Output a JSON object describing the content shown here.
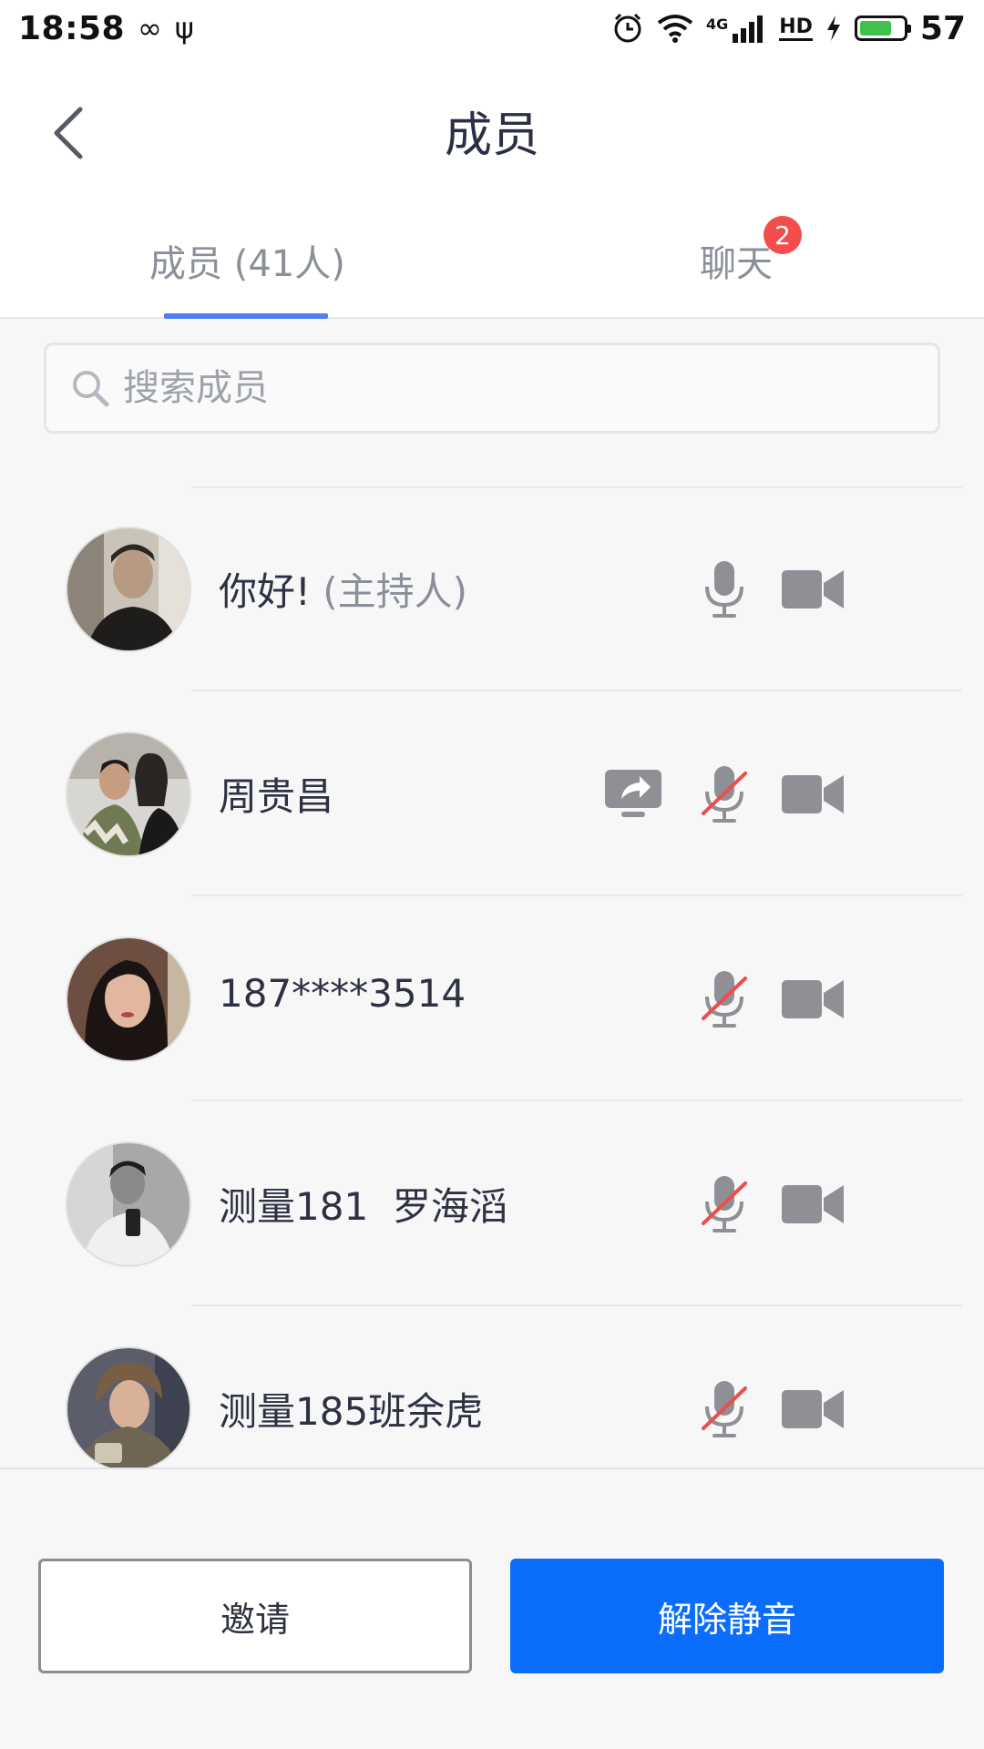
{
  "status_bar": {
    "time": "18:58",
    "infinity": "∞",
    "usb": "ψ",
    "signal_type": "4G",
    "hd": "HD",
    "battery_level": "57"
  },
  "header": {
    "title": "成员"
  },
  "tabs": {
    "members_label": "成员 (41人)",
    "chat_label": "聊天",
    "chat_badge": "2"
  },
  "search": {
    "placeholder": "搜索成员"
  },
  "members": [
    {
      "name": "你好!",
      "role": "(主持人)",
      "mic": "on",
      "camera": "on",
      "sharing": false
    },
    {
      "name": "周贵昌",
      "role": "",
      "mic": "muted",
      "camera": "on",
      "sharing": true
    },
    {
      "name": "187****3514",
      "role": "",
      "mic": "muted",
      "camera": "on",
      "sharing": false
    },
    {
      "name": "测量181  罗海滔",
      "role": "",
      "mic": "muted",
      "camera": "on",
      "sharing": false
    },
    {
      "name": "测量185班余虎",
      "role": "",
      "mic": "muted",
      "camera": "on",
      "sharing": false
    }
  ],
  "actions": {
    "invite_label": "邀请",
    "unmute_label": "解除静音"
  },
  "colors": {
    "accent": "#0b6dfc",
    "tab_underline": "#4f7ef5",
    "badge": "#f44d4d",
    "muted_slash": "#e8504d",
    "icon_gray": "#8e9096"
  }
}
